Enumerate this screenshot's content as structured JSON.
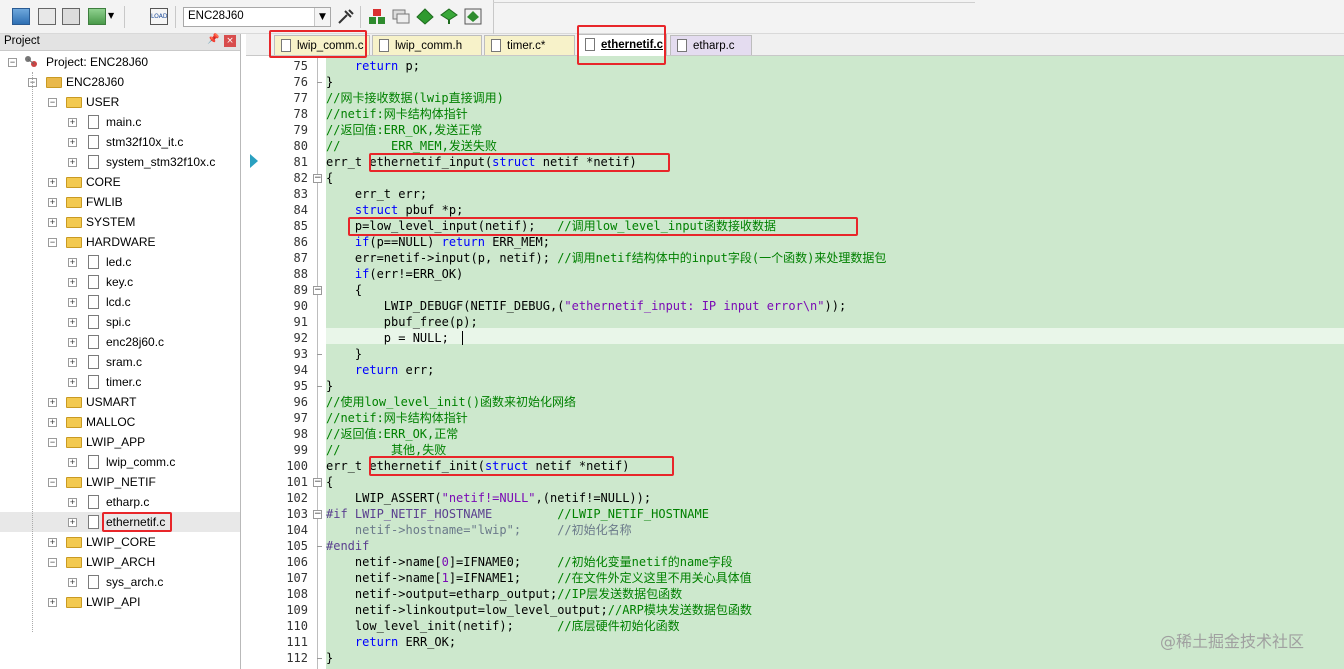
{
  "toolbar": {
    "target_value": "ENC28J60",
    "load_label": "LOAD"
  },
  "project_panel": {
    "title": "Project",
    "tree": [
      {
        "label": "Project: ENC28J60",
        "kind": "project",
        "level": 0,
        "expanded": true
      },
      {
        "label": "ENC28J60",
        "kind": "target",
        "level": 1,
        "expanded": true
      },
      {
        "label": "USER",
        "kind": "folder",
        "level": 2,
        "expanded": true
      },
      {
        "label": "main.c",
        "kind": "file",
        "level": 3
      },
      {
        "label": "stm32f10x_it.c",
        "kind": "file",
        "level": 3
      },
      {
        "label": "system_stm32f10x.c",
        "kind": "file",
        "level": 3
      },
      {
        "label": "CORE",
        "kind": "folder",
        "level": 2,
        "expanded": false
      },
      {
        "label": "FWLIB",
        "kind": "folder",
        "level": 2,
        "expanded": false
      },
      {
        "label": "SYSTEM",
        "kind": "folder",
        "level": 2,
        "expanded": false
      },
      {
        "label": "HARDWARE",
        "kind": "folder",
        "level": 2,
        "expanded": true
      },
      {
        "label": "led.c",
        "kind": "file",
        "level": 3
      },
      {
        "label": "key.c",
        "kind": "file",
        "level": 3
      },
      {
        "label": "lcd.c",
        "kind": "file",
        "level": 3
      },
      {
        "label": "spi.c",
        "kind": "file",
        "level": 3
      },
      {
        "label": "enc28j60.c",
        "kind": "file",
        "level": 3
      },
      {
        "label": "sram.c",
        "kind": "file",
        "level": 3
      },
      {
        "label": "timer.c",
        "kind": "file",
        "level": 3
      },
      {
        "label": "USMART",
        "kind": "folder",
        "level": 2,
        "expanded": false
      },
      {
        "label": "MALLOC",
        "kind": "folder",
        "level": 2,
        "expanded": false
      },
      {
        "label": "LWIP_APP",
        "kind": "folder",
        "level": 2,
        "expanded": true
      },
      {
        "label": "lwip_comm.c",
        "kind": "file",
        "level": 3
      },
      {
        "label": "LWIP_NETIF",
        "kind": "folder",
        "level": 2,
        "expanded": true
      },
      {
        "label": "etharp.c",
        "kind": "file",
        "level": 3
      },
      {
        "label": "ethernetif.c",
        "kind": "file",
        "level": 3,
        "highlighted": true
      },
      {
        "label": "LWIP_CORE",
        "kind": "folder",
        "level": 2,
        "expanded": false
      },
      {
        "label": "LWIP_ARCH",
        "kind": "folder",
        "level": 2,
        "expanded": true
      },
      {
        "label": "sys_arch.c",
        "kind": "file",
        "level": 3
      },
      {
        "label": "LWIP_API",
        "kind": "folder",
        "level": 2,
        "expanded": false
      }
    ]
  },
  "tabs": [
    {
      "label": "lwip_comm.c",
      "active": false,
      "highlighted": true
    },
    {
      "label": "lwip_comm.h",
      "active": false,
      "highlighted": false
    },
    {
      "label": "timer.c*",
      "active": false,
      "highlighted": false
    },
    {
      "label": "ethernetif.c",
      "active": true,
      "highlighted": true
    },
    {
      "label": "etharp.c",
      "active": false,
      "highlighted": false
    }
  ],
  "editor": {
    "lines": [
      {
        "n": "75",
        "fold": "",
        "parts": [
          [
            "",
            "    "
          ],
          [
            "k",
            "return"
          ],
          [
            "",
            " p;"
          ]
        ]
      },
      {
        "n": "76",
        "fold": "end",
        "parts": [
          [
            "",
            "}"
          ]
        ]
      },
      {
        "n": "77",
        "fold": "",
        "parts": [
          [
            "c",
            "//网卡接收数据(lwip直接调用)"
          ]
        ]
      },
      {
        "n": "78",
        "fold": "",
        "parts": [
          [
            "c",
            "//netif:网卡结构体指针"
          ]
        ]
      },
      {
        "n": "79",
        "fold": "",
        "parts": [
          [
            "c",
            "//返回值:ERR_OK,发送正常"
          ]
        ]
      },
      {
        "n": "80",
        "fold": "",
        "parts": [
          [
            "c",
            "//       ERR_MEM,发送失败"
          ]
        ]
      },
      {
        "n": "81",
        "fold": "",
        "parts": [
          [
            "",
            "err_t ethernetif_input("
          ],
          [
            "k",
            "struct"
          ],
          [
            "",
            " netif *netif)"
          ]
        ]
      },
      {
        "n": "82",
        "fold": "open",
        "parts": [
          [
            "",
            "{"
          ]
        ]
      },
      {
        "n": "83",
        "fold": "",
        "parts": [
          [
            "",
            "    err_t err;"
          ]
        ]
      },
      {
        "n": "84",
        "fold": "",
        "parts": [
          [
            "",
            "    "
          ],
          [
            "k",
            "struct"
          ],
          [
            "",
            " pbuf *p;"
          ]
        ]
      },
      {
        "n": "85",
        "fold": "",
        "parts": [
          [
            "",
            "    p=low_level_input(netif);   "
          ],
          [
            "c",
            "//调用low_level_input函数接收数据"
          ]
        ]
      },
      {
        "n": "86",
        "fold": "",
        "parts": [
          [
            "",
            "    "
          ],
          [
            "k",
            "if"
          ],
          [
            "",
            "(p==NULL) "
          ],
          [
            "k",
            "return"
          ],
          [
            "",
            " ERR_MEM;"
          ]
        ]
      },
      {
        "n": "87",
        "fold": "",
        "parts": [
          [
            "",
            "    err=netif->input(p, netif); "
          ],
          [
            "c",
            "//调用netif结构体中的input字段(一个函数)来处理数据包"
          ]
        ]
      },
      {
        "n": "88",
        "fold": "",
        "parts": [
          [
            "",
            "    "
          ],
          [
            "k",
            "if"
          ],
          [
            "",
            "(err!=ERR_OK)"
          ]
        ]
      },
      {
        "n": "89",
        "fold": "open",
        "parts": [
          [
            "",
            "    {"
          ]
        ]
      },
      {
        "n": "90",
        "fold": "",
        "parts": [
          [
            "",
            "        LWIP_DEBUGF(NETIF_DEBUG,("
          ],
          [
            "s",
            "\"ethernetif_input: IP input error\\n\""
          ],
          [
            "",
            "));"
          ]
        ]
      },
      {
        "n": "91",
        "fold": "",
        "parts": [
          [
            "",
            "        pbuf_free(p);"
          ]
        ]
      },
      {
        "n": "92",
        "fold": "",
        "parts": [
          [
            "",
            "        p = NULL;"
          ]
        ]
      },
      {
        "n": "93",
        "fold": "end",
        "parts": [
          [
            "",
            "    }"
          ]
        ]
      },
      {
        "n": "94",
        "fold": "",
        "parts": [
          [
            "",
            "    "
          ],
          [
            "k",
            "return"
          ],
          [
            "",
            " err;"
          ]
        ]
      },
      {
        "n": "95",
        "fold": "end",
        "parts": [
          [
            "",
            "}"
          ]
        ]
      },
      {
        "n": "96",
        "fold": "",
        "parts": [
          [
            "c",
            "//使用low_level_init()函数来初始化网络"
          ]
        ]
      },
      {
        "n": "97",
        "fold": "",
        "parts": [
          [
            "c",
            "//netif:网卡结构体指针"
          ]
        ]
      },
      {
        "n": "98",
        "fold": "",
        "parts": [
          [
            "c",
            "//返回值:ERR_OK,正常"
          ]
        ]
      },
      {
        "n": "99",
        "fold": "",
        "parts": [
          [
            "c",
            "//       其他,失败"
          ]
        ]
      },
      {
        "n": "100",
        "fold": "",
        "parts": [
          [
            "",
            "err_t ethernetif_init("
          ],
          [
            "k",
            "struct"
          ],
          [
            "",
            " netif *netif)"
          ]
        ]
      },
      {
        "n": "101",
        "fold": "open",
        "parts": [
          [
            "",
            "{"
          ]
        ]
      },
      {
        "n": "102",
        "fold": "",
        "parts": [
          [
            "",
            "    LWIP_ASSERT("
          ],
          [
            "s",
            "\"netif!=NULL\""
          ],
          [
            "",
            ",(netif!=NULL));"
          ]
        ]
      },
      {
        "n": "103",
        "fold": "open",
        "parts": [
          [
            "p",
            "#if LWIP_NETIF_HOSTNAME"
          ],
          [
            "",
            "         "
          ],
          [
            "c",
            "//LWIP_NETIF_HOSTNAME"
          ]
        ]
      },
      {
        "n": "104",
        "fold": "",
        "parts": [
          [
            "d",
            "    netif->hostname=\"lwip\";     //初始化名称"
          ]
        ]
      },
      {
        "n": "105",
        "fold": "end",
        "parts": [
          [
            "p",
            "#endif"
          ]
        ]
      },
      {
        "n": "106",
        "fold": "",
        "parts": [
          [
            "",
            "    netif->name["
          ],
          [
            "n",
            "0"
          ],
          [
            "",
            "]=IFNAME0;     "
          ],
          [
            "c",
            "//初始化变量netif的name字段"
          ]
        ]
      },
      {
        "n": "107",
        "fold": "",
        "parts": [
          [
            "",
            "    netif->name["
          ],
          [
            "n",
            "1"
          ],
          [
            "",
            "]=IFNAME1;     "
          ],
          [
            "c",
            "//在文件外定义这里不用关心具体值"
          ]
        ]
      },
      {
        "n": "108",
        "fold": "",
        "parts": [
          [
            "",
            "    netif->output=etharp_output;"
          ],
          [
            "c",
            "//IP层发送数据包函数"
          ]
        ]
      },
      {
        "n": "109",
        "fold": "",
        "parts": [
          [
            "",
            "    netif->linkoutput=low_level_output;"
          ],
          [
            "c",
            "//ARP模块发送数据包函数"
          ]
        ]
      },
      {
        "n": "110",
        "fold": "",
        "parts": [
          [
            "",
            "    low_level_init(netif);      "
          ],
          [
            "c",
            "//底层硬件初始化函数"
          ]
        ]
      },
      {
        "n": "111",
        "fold": "",
        "parts": [
          [
            "",
            "    "
          ],
          [
            "k",
            "return"
          ],
          [
            "",
            " ERR_OK;"
          ]
        ]
      },
      {
        "n": "112",
        "fold": "end",
        "parts": [
          [
            "",
            "}"
          ]
        ]
      }
    ]
  },
  "watermark": "@稀土掘金技术社区",
  "colors": {
    "highlight_box": "#e8262a",
    "code_bg": "#cde8cd",
    "keyword": "#0000ff",
    "comment": "#008000",
    "string": "#7a0bb5"
  }
}
